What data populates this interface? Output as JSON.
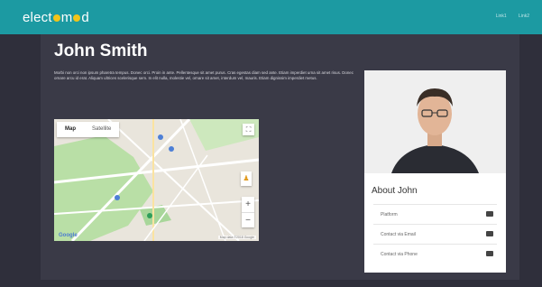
{
  "header": {
    "logo_prefix": "elect",
    "logo_mid": "m",
    "logo_suffix": "d",
    "nav": [
      "Link1",
      "Link2"
    ]
  },
  "profile": {
    "name": "John Smith",
    "bio": "Morbi non orci non ipsum pharetra tempus. Donec orci. Proin in ante. Pellentesque sit amet purus. Cras egestas diam sed ante. Etiam imperdiet urna sit amet risus. Donec ornare arcu id erat. Aliquam ultrices scelerisque sem. In elit nulla, molestie vel, ornare sit amet, interdum vel, mauris. Etiam dignissim imperdiet metus."
  },
  "map": {
    "tabs": [
      "Map",
      "Satellite"
    ],
    "active_tab": "Map",
    "zoom_in": "+",
    "zoom_out": "−",
    "provider": "Google",
    "attribution": "Map data ©2018 Google"
  },
  "card": {
    "title": "About John",
    "items": [
      {
        "label": "Platform",
        "icon": "briefcase-icon"
      },
      {
        "label": "Contact via Email",
        "icon": "envelope-icon"
      },
      {
        "label": "Contact via Phone",
        "icon": "phone-icon"
      }
    ]
  },
  "colors": {
    "topbar": "#1c9aa2",
    "background": "#2f2f3b",
    "panel": "#3a3a47",
    "logo_accent": "#f0c419"
  }
}
